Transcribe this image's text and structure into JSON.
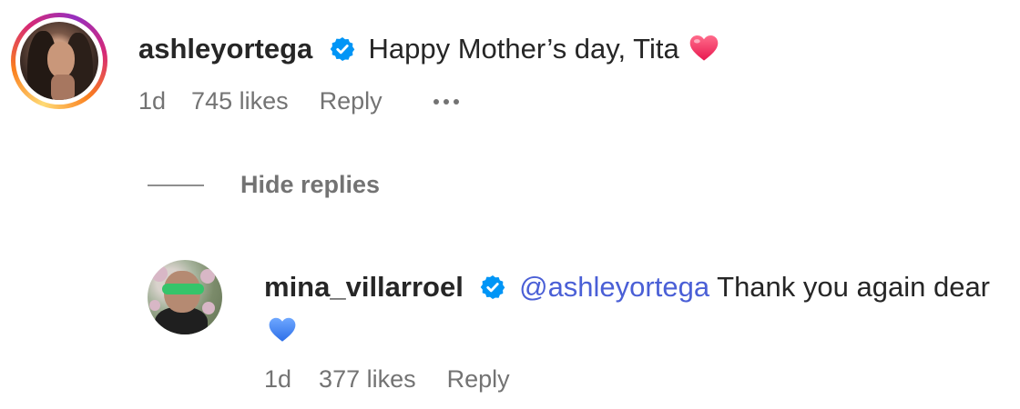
{
  "main_comment": {
    "username": "ashleyortega",
    "verified": true,
    "text": "Happy Mother’s day, Tita",
    "emoji": "red-heart",
    "time": "1d",
    "likes": "745 likes",
    "reply_label": "Reply",
    "more_icon": "more-horizontal-icon"
  },
  "replies_toggle": {
    "label": "Hide replies"
  },
  "reply_comment": {
    "username": "mina_villarroel",
    "verified": true,
    "mention": "@ashleyortega",
    "text": " Thank you again dear",
    "emoji": "blue-heart",
    "time": "1d",
    "likes": "377 likes",
    "reply_label": "Reply"
  },
  "colors": {
    "verified_blue": "#0095f6",
    "mention_blue": "#4a5fd6",
    "muted_text": "#737373",
    "primary_text": "#262626"
  }
}
